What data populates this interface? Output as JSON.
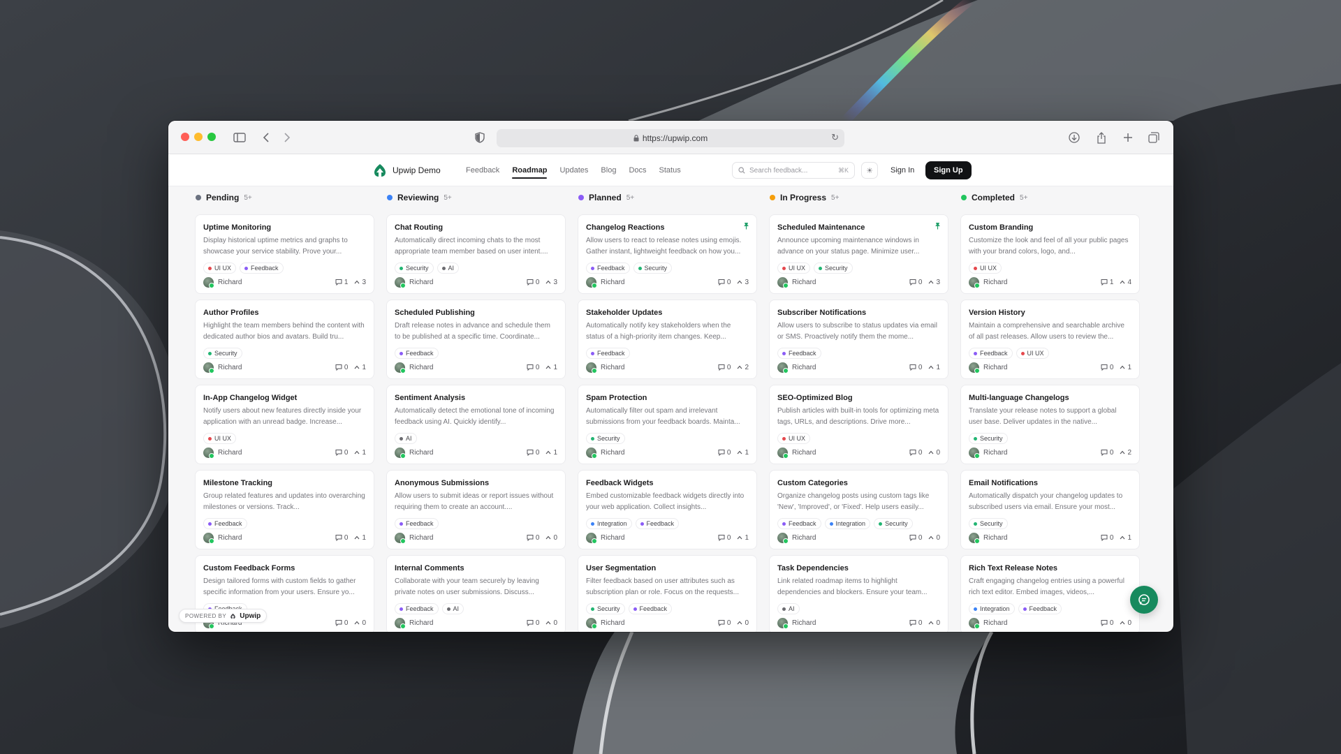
{
  "browser": {
    "url": "https://upwip.com"
  },
  "nav": {
    "brand": "Upwip Demo",
    "links": [
      {
        "label": "Feedback",
        "active": false
      },
      {
        "label": "Roadmap",
        "active": true
      },
      {
        "label": "Updates",
        "active": false
      },
      {
        "label": "Blog",
        "active": false
      },
      {
        "label": "Docs",
        "active": false
      },
      {
        "label": "Status",
        "active": false
      }
    ],
    "search_placeholder": "Search feedback...",
    "search_shortcut": "⌘K",
    "sign_in": "Sign In",
    "sign_up": "Sign Up"
  },
  "tag_colors": {
    "UI UX": "#e5484d",
    "Feedback": "#8b5cf6",
    "Security": "#22b573",
    "AI": "#6b6b70",
    "Integration": "#3b82f6"
  },
  "columns": [
    {
      "name": "Pending",
      "count": "5+",
      "color": "#6b7280",
      "cards": [
        {
          "title": "Uptime Monitoring",
          "desc": "Display historical uptime metrics and graphs to showcase your service stability. Prove your...",
          "tags": [
            "UI UX",
            "Feedback"
          ],
          "author": "Richard",
          "comments": "1",
          "votes": "3",
          "pinned": false
        },
        {
          "title": "Author Profiles",
          "desc": "Highlight the team members behind the content with dedicated author bios and avatars. Build tru...",
          "tags": [
            "Security"
          ],
          "author": "Richard",
          "comments": "0",
          "votes": "1",
          "pinned": false
        },
        {
          "title": "In-App Changelog Widget",
          "desc": "Notify users about new features directly inside your application with an unread badge. Increase...",
          "tags": [
            "UI UX"
          ],
          "author": "Richard",
          "comments": "0",
          "votes": "1",
          "pinned": false
        },
        {
          "title": "Milestone Tracking",
          "desc": "Group related features and updates into overarching milestones or versions. Track...",
          "tags": [
            "Feedback"
          ],
          "author": "Richard",
          "comments": "0",
          "votes": "1",
          "pinned": false
        },
        {
          "title": "Custom Feedback Forms",
          "desc": "Design tailored forms with custom fields to gather specific information from your users. Ensure yo...",
          "tags": [
            "Feedback"
          ],
          "author": "Richard",
          "comments": "0",
          "votes": "0",
          "pinned": false
        }
      ]
    },
    {
      "name": "Reviewing",
      "count": "5+",
      "color": "#3b82f6",
      "cards": [
        {
          "title": "Chat Routing",
          "desc": "Automatically direct incoming chats to the most appropriate team member based on user intent....",
          "tags": [
            "Security",
            "AI"
          ],
          "author": "Richard",
          "comments": "0",
          "votes": "3",
          "pinned": false
        },
        {
          "title": "Scheduled Publishing",
          "desc": "Draft release notes in advance and schedule them to be published at a specific time. Coordinate...",
          "tags": [
            "Feedback"
          ],
          "author": "Richard",
          "comments": "0",
          "votes": "1",
          "pinned": false
        },
        {
          "title": "Sentiment Analysis",
          "desc": "Automatically detect the emotional tone of incoming feedback using AI. Quickly identify...",
          "tags": [
            "AI"
          ],
          "author": "Richard",
          "comments": "0",
          "votes": "1",
          "pinned": false
        },
        {
          "title": "Anonymous Submissions",
          "desc": "Allow users to submit ideas or report issues without requiring them to create an account....",
          "tags": [
            "Feedback"
          ],
          "author": "Richard",
          "comments": "0",
          "votes": "0",
          "pinned": false
        },
        {
          "title": "Internal Comments",
          "desc": "Collaborate with your team securely by leaving private notes on user submissions. Discuss...",
          "tags": [
            "Feedback",
            "AI"
          ],
          "author": "Richard",
          "comments": "0",
          "votes": "0",
          "pinned": false
        }
      ]
    },
    {
      "name": "Planned",
      "count": "5+",
      "color": "#8b5cf6",
      "cards": [
        {
          "title": "Changelog Reactions",
          "desc": "Allow users to react to release notes using emojis. Gather instant, lightweight feedback on how you...",
          "tags": [
            "Feedback",
            "Security"
          ],
          "author": "Richard",
          "comments": "0",
          "votes": "3",
          "pinned": true
        },
        {
          "title": "Stakeholder Updates",
          "desc": "Automatically notify key stakeholders when the status of a high-priority item changes. Keep...",
          "tags": [
            "Feedback"
          ],
          "author": "Richard",
          "comments": "0",
          "votes": "2",
          "pinned": false
        },
        {
          "title": "Spam Protection",
          "desc": "Automatically filter out spam and irrelevant submissions from your feedback boards. Mainta...",
          "tags": [
            "Security"
          ],
          "author": "Richard",
          "comments": "0",
          "votes": "1",
          "pinned": false
        },
        {
          "title": "Feedback Widgets",
          "desc": "Embed customizable feedback widgets directly into your web application. Collect insights...",
          "tags": [
            "Integration",
            "Feedback"
          ],
          "author": "Richard",
          "comments": "0",
          "votes": "1",
          "pinned": false
        },
        {
          "title": "User Segmentation",
          "desc": "Filter feedback based on user attributes such as subscription plan or role. Focus on the requests...",
          "tags": [
            "Security",
            "Feedback"
          ],
          "author": "Richard",
          "comments": "0",
          "votes": "0",
          "pinned": false
        }
      ]
    },
    {
      "name": "In Progress",
      "count": "5+",
      "color": "#f59e0b",
      "cards": [
        {
          "title": "Scheduled Maintenance",
          "desc": "Announce upcoming maintenance windows in advance on your status page. Minimize user...",
          "tags": [
            "UI UX",
            "Security"
          ],
          "author": "Richard",
          "comments": "0",
          "votes": "3",
          "pinned": true
        },
        {
          "title": "Subscriber Notifications",
          "desc": "Allow users to subscribe to status updates via email or SMS. Proactively notify them the mome...",
          "tags": [
            "Feedback"
          ],
          "author": "Richard",
          "comments": "0",
          "votes": "1",
          "pinned": false
        },
        {
          "title": "SEO-Optimized Blog",
          "desc": "Publish articles with built-in tools for optimizing meta tags, URLs, and descriptions. Drive more...",
          "tags": [
            "UI UX"
          ],
          "author": "Richard",
          "comments": "0",
          "votes": "0",
          "pinned": false
        },
        {
          "title": "Custom Categories",
          "desc": "Organize changelog posts using custom tags like 'New', 'Improved', or 'Fixed'. Help users easily...",
          "tags": [
            "Feedback",
            "Integration",
            "Security"
          ],
          "author": "Richard",
          "comments": "0",
          "votes": "0",
          "pinned": false
        },
        {
          "title": "Task Dependencies",
          "desc": "Link related roadmap items to highlight dependencies and blockers. Ensure your team...",
          "tags": [
            "AI"
          ],
          "author": "Richard",
          "comments": "0",
          "votes": "0",
          "pinned": false
        }
      ]
    },
    {
      "name": "Completed",
      "count": "5+",
      "color": "#22c55e",
      "cards": [
        {
          "title": "Custom Branding",
          "desc": "Customize the look and feel of all your public pages with your brand colors, logo, and...",
          "tags": [
            "UI UX"
          ],
          "author": "Richard",
          "comments": "1",
          "votes": "4",
          "pinned": false
        },
        {
          "title": "Version History",
          "desc": "Maintain a comprehensive and searchable archive of all past releases. Allow users to review the...",
          "tags": [
            "Feedback",
            "UI UX"
          ],
          "author": "Richard",
          "comments": "0",
          "votes": "1",
          "pinned": false
        },
        {
          "title": "Multi-language Changelogs",
          "desc": "Translate your release notes to support a global user base. Deliver updates in the native...",
          "tags": [
            "Security"
          ],
          "author": "Richard",
          "comments": "0",
          "votes": "2",
          "pinned": false
        },
        {
          "title": "Email Notifications",
          "desc": "Automatically dispatch your changelog updates to subscribed users via email. Ensure your most...",
          "tags": [
            "Security"
          ],
          "author": "Richard",
          "comments": "0",
          "votes": "1",
          "pinned": false
        },
        {
          "title": "Rich Text Release Notes",
          "desc": "Craft engaging changelog entries using a powerful rich text editor. Embed images, videos,...",
          "tags": [
            "Integration",
            "Feedback"
          ],
          "author": "Richard",
          "comments": "0",
          "votes": "0",
          "pinned": false
        }
      ]
    }
  ],
  "powered_by": {
    "prefix": "POWERED BY",
    "brand": "Upwip"
  }
}
